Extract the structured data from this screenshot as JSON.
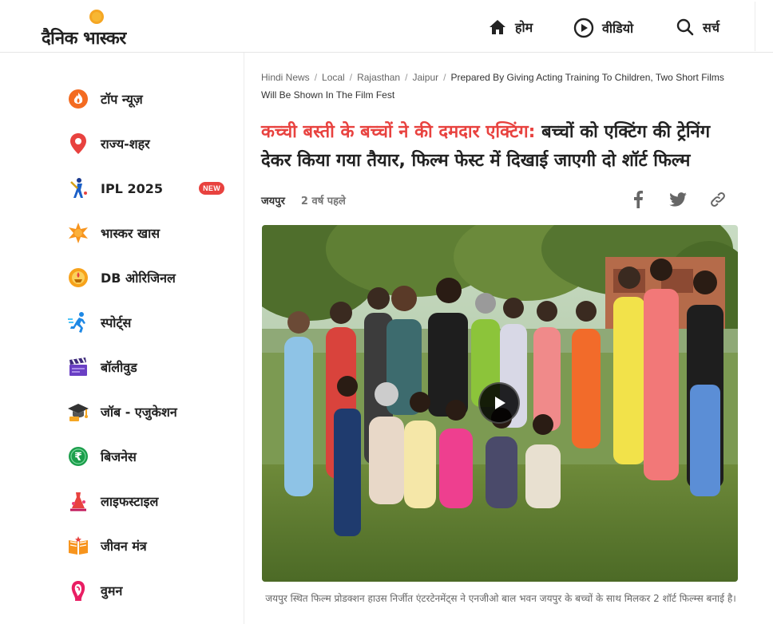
{
  "header": {
    "logo_text": "दैनिक भास्कर",
    "nav": [
      {
        "label": "होम",
        "icon": "home-icon"
      },
      {
        "label": "वीडियो",
        "icon": "play-circle-icon"
      },
      {
        "label": "सर्च",
        "icon": "search-icon"
      }
    ]
  },
  "sidebar": {
    "items": [
      {
        "label": "टॉप न्यूज़",
        "icon": "flame-icon"
      },
      {
        "label": "राज्य-शहर",
        "icon": "location-pin-icon"
      },
      {
        "label": "IPL 2025",
        "icon": "cricket-batsman-icon",
        "badge": "NEW"
      },
      {
        "label": "भास्कर खास",
        "icon": "star-burst-icon"
      },
      {
        "label": "DB ओरिजिनल",
        "icon": "lamp-icon"
      },
      {
        "label": "स्पोर्ट्स",
        "icon": "runner-icon"
      },
      {
        "label": "बॉलीवुड",
        "icon": "clapperboard-icon"
      },
      {
        "label": "जॉब - एजुकेशन",
        "icon": "graduation-cap-icon"
      },
      {
        "label": "बिजनेस",
        "icon": "rupee-coin-icon"
      },
      {
        "label": "लाइफस्टाइल",
        "icon": "dress-icon"
      },
      {
        "label": "जीवन मंत्र",
        "icon": "book-icon"
      },
      {
        "label": "वुमन",
        "icon": "woman-icon"
      }
    ]
  },
  "article": {
    "breadcrumb": [
      "Hindi News",
      "Local",
      "Rajasthan",
      "Jaipur"
    ],
    "breadcrumb_current": "Prepared By Giving Acting Training To Children, Two Short Films Will Be Shown In The Film Fest",
    "headline_highlight": "कच्ची बस्ती के बच्चों ने की दमदार एक्टिंग:",
    "headline_rest": " बच्चों को एक्टिंग की ट्रेनिंग देकर किया गया तैयार, फिल्म फेस्ट में दिखाई जाएगी दो शॉर्ट फिल्म",
    "city": "जयपुर",
    "time": "2 वर्ष पहले",
    "caption": "जयपुर स्थित फिल्म प्रोडक्शन हाउस निर्जीत एंटरटेनमेंट्स ने एनजीओ बाल भवन जयपुर के बच्चों के साथ मिलकर 2 शॉर्ट फिल्म्स बनाई है।"
  },
  "colors": {
    "accent_red": "#e8423f",
    "logo_orange": "#f5a623"
  }
}
